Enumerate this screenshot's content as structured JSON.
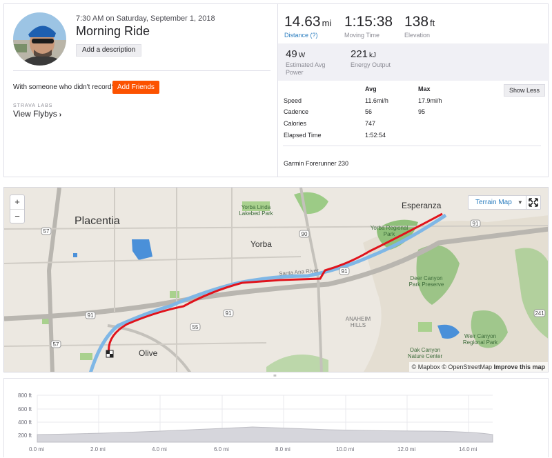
{
  "activity": {
    "datetime": "7:30 AM on Saturday, September 1, 2018",
    "title": "Morning Ride",
    "add_description": "Add a description",
    "with_someone": "With someone who didn't record?",
    "add_friends": "Add Friends",
    "labs_label": "STRAVA LABS",
    "flybys": "View Flybys"
  },
  "stats": {
    "distance": {
      "value": "14.63",
      "unit": "mi",
      "label": "Distance (?)"
    },
    "moving_time": {
      "value": "1:15:38",
      "label": "Moving Time"
    },
    "elevation": {
      "value": "138",
      "unit": "ft",
      "label": "Elevation"
    },
    "power": {
      "value": "49",
      "unit": "W",
      "label": "Estimated Avg Power"
    },
    "energy": {
      "value": "221",
      "unit": "kJ",
      "label": "Energy Output"
    }
  },
  "details": {
    "col_avg": "Avg",
    "col_max": "Max",
    "show_less": "Show Less",
    "rows": [
      {
        "label": "Speed",
        "avg": "11.6mi/h",
        "max": "17.9mi/h"
      },
      {
        "label": "Cadence",
        "avg": "56",
        "max": "95"
      },
      {
        "label": "Calories",
        "avg": "747",
        "max": ""
      },
      {
        "label": "Elapsed Time",
        "avg": "1:52:54",
        "max": ""
      }
    ],
    "device": "Garmin Forerunner 230"
  },
  "map": {
    "zoom_in": "+",
    "zoom_out": "−",
    "map_type": "Terrain Map",
    "attribution_mapbox": "© Mapbox",
    "attribution_osm": "© OpenStreetMap",
    "improve": "Improve this map",
    "labels": {
      "placentia": "Placentia",
      "yorba": "Yorba",
      "esperanza": "Esperanza",
      "olive": "Olive",
      "anaheim_hills": "ANAHEIM HILLS",
      "yorba_linda_park": "Yorba Linda Lakebed Park",
      "yorba_regional_park": "Yorba Regional Park",
      "deer_canyon": "Deer Canyon Park Preserve",
      "weir_canyon": "Weir Canyon Regional Park",
      "oak_canyon": "Oak Canyon Nature Center",
      "santa_ana_river": "Santa Ana River",
      "route_57_top": "57",
      "route_57_bottom": "57",
      "route_90": "90",
      "route_91_left": "91",
      "route_91_mid": "91",
      "route_91_right": "91",
      "route_91_far": "91",
      "route_55": "55",
      "route_241": "241"
    },
    "route_color": "#e0131c",
    "river_color": "#5fa8e0"
  },
  "elevation_chart": {
    "y_ticks": [
      "800 ft",
      "600 ft",
      "400 ft",
      "200 ft"
    ],
    "x_ticks": [
      "0.0 mi",
      "2.0 mi",
      "4.0 mi",
      "6.0 mi",
      "8.0 mi",
      "10.0 mi",
      "12.0 mi",
      "14.0 mi"
    ]
  }
}
